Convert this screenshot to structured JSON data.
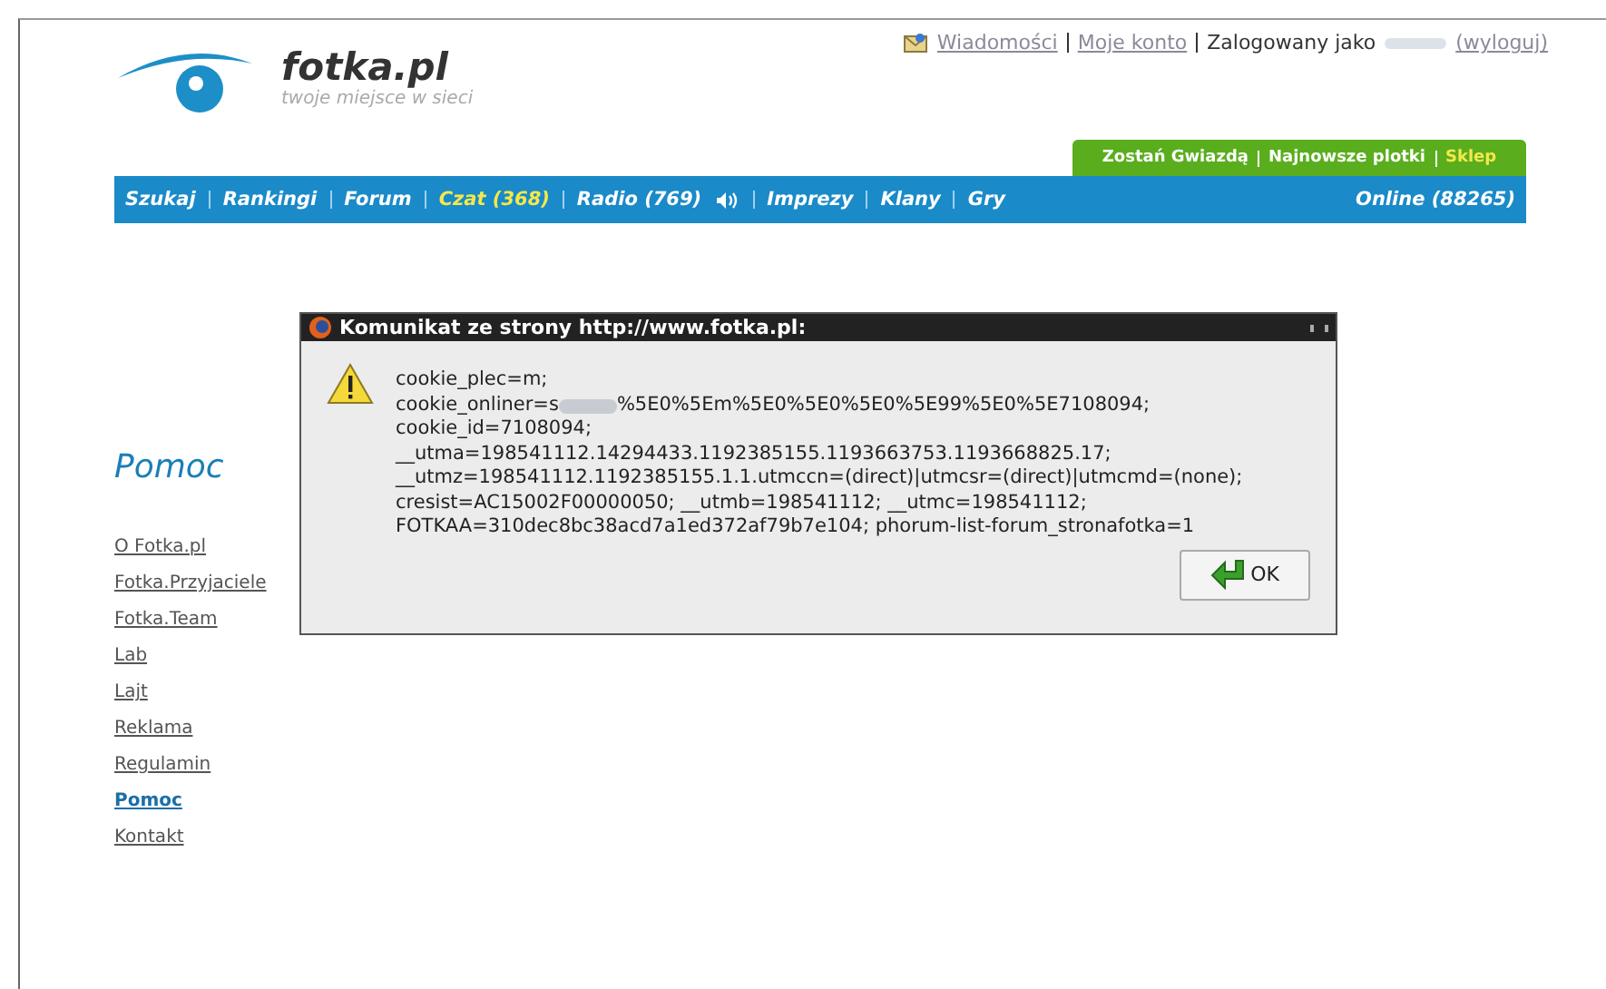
{
  "logo": {
    "name": "fotka.pl",
    "tagline": "twoje miejsce w sieci"
  },
  "user_bar": {
    "links": [
      "Wiadomości",
      "Moje konto"
    ],
    "logged_in_label": "Zalogowany jako",
    "logout": "(wyloguj)"
  },
  "promo_tabs": [
    {
      "label": "Zostań Gwiazdą",
      "highlighted": false
    },
    {
      "label": "Najnowsze plotki",
      "highlighted": false
    },
    {
      "label": "Sklep",
      "highlighted": true
    }
  ],
  "nav": {
    "items": [
      {
        "label": "Szukaj",
        "highlighted": false,
        "sound": false
      },
      {
        "label": "Rankingi",
        "highlighted": false,
        "sound": false
      },
      {
        "label": "Forum",
        "highlighted": false,
        "sound": false
      },
      {
        "label": "Czat (368)",
        "highlighted": true,
        "sound": false
      },
      {
        "label": "Radio (769)",
        "highlighted": false,
        "sound": true
      },
      {
        "label": "Imprezy",
        "highlighted": false,
        "sound": false
      },
      {
        "label": "Klany",
        "highlighted": false,
        "sound": false
      },
      {
        "label": "Gry",
        "highlighted": false,
        "sound": false
      }
    ],
    "online": "Online (88265)"
  },
  "sidebar": {
    "title": "Pomoc",
    "items": [
      {
        "label": "O Fotka.pl",
        "selected": false
      },
      {
        "label": "Fotka.Przyjaciele",
        "selected": false
      },
      {
        "label": "Fotka.Team",
        "selected": false
      },
      {
        "label": "Lab",
        "selected": false
      },
      {
        "label": "Lajt",
        "selected": false
      },
      {
        "label": "Reklama",
        "selected": false
      },
      {
        "label": "Regulamin",
        "selected": false
      },
      {
        "label": "Pomoc",
        "selected": true
      },
      {
        "label": "Kontakt",
        "selected": false
      }
    ]
  },
  "dialog": {
    "title": "Komunikat ze strony http://www.fotka.pl:",
    "lines": [
      {
        "kind": "plain",
        "text": "cookie_plec=m;"
      },
      {
        "kind": "redacted",
        "before": "cookie_onliner=s",
        "after": "%5E0%5Em%5E0%5E0%5E0%5E99%5E0%5E7108094;"
      },
      {
        "kind": "plain",
        "text": "cookie_id=7108094;"
      },
      {
        "kind": "plain",
        "text": "__utma=198541112.14294433.1192385155.1193663753.1193668825.17;"
      },
      {
        "kind": "plain",
        "text": "__utmz=198541112.1192385155.1.1.utmccn=(direct)|utmcsr=(direct)|utmcmd=(none);"
      },
      {
        "kind": "plain",
        "text": "cresist=AC15002F00000050; __utmb=198541112; __utmc=198541112;"
      },
      {
        "kind": "plain",
        "text": "FOTKAA=310dec8bc38acd7a1ed372af79b7e104; phorum-list-forum_stronafotka=1"
      }
    ],
    "button": "OK"
  }
}
